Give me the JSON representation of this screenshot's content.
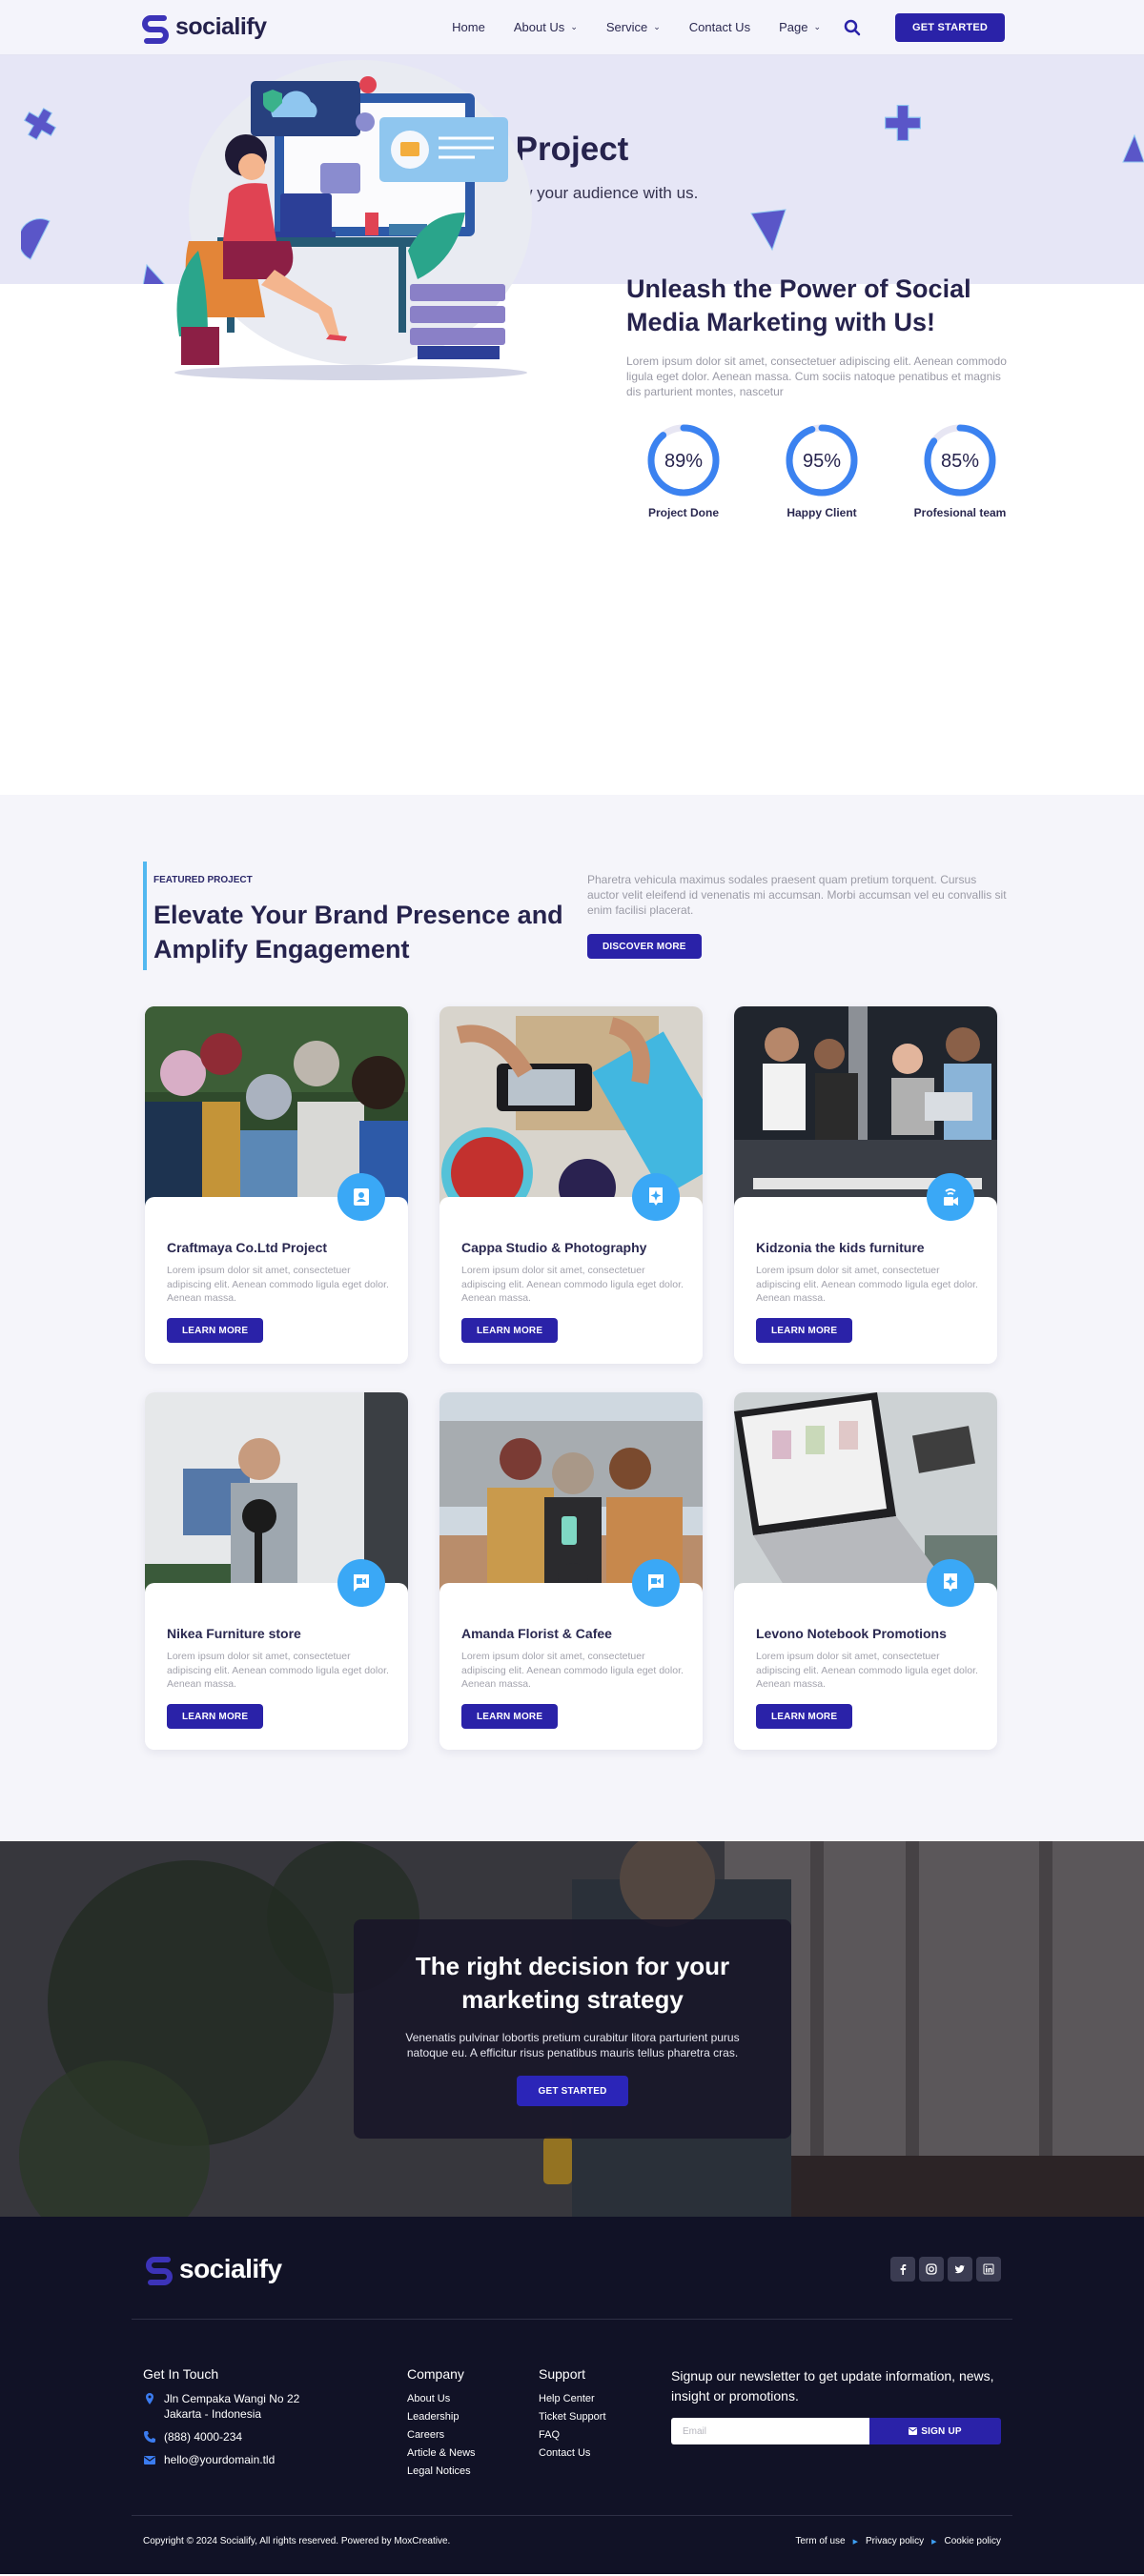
{
  "brand": {
    "name": "socialify",
    "accent": "#2a22a8",
    "icon_blue": "#3aa8f6",
    "ring_blue": "#3b82f0"
  },
  "nav": {
    "items": [
      {
        "label": "Home",
        "has_dropdown": false
      },
      {
        "label": "About Us",
        "has_dropdown": true
      },
      {
        "label": "Service",
        "has_dropdown": true
      },
      {
        "label": "Contact Us",
        "has_dropdown": false
      },
      {
        "label": "Page",
        "has_dropdown": true
      }
    ],
    "search_icon": "search-icon",
    "cta_label": "GET STARTED"
  },
  "hero": {
    "title": "Project",
    "subtitle": "Get to know your audience with us."
  },
  "about": {
    "heading": "Unleash the Power of Social Media Marketing with Us!",
    "text": "Lorem ipsum dolor sit amet, consectetuer adipiscing elit. Aenean commodo ligula eget dolor. Aenean massa. Cum sociis natoque penatibus et magnis dis parturient montes, nascetur",
    "stats": [
      {
        "value": "89%",
        "percent": 89,
        "label": "Project Done"
      },
      {
        "value": "95%",
        "percent": 95,
        "label": "Happy Client"
      },
      {
        "value": "85%",
        "percent": 85,
        "label": "Profesional team"
      }
    ]
  },
  "featured": {
    "eyebrow": "FEATURED PROJECT",
    "title": "Elevate Your Brand Presence and Amplify Engagement",
    "description": "Pharetra vehicula maximus sodales praesent quam pretium torquent. Cursus auctor velit eleifend id venenatis mi accumsan. Morbi accumsan vel eu convallis sit enim facilisi placerat.",
    "button_label": "DISCOVER MORE",
    "projects": [
      {
        "title": "Craftmaya Co.Ltd Project",
        "text": "Lorem ipsum dolor sit amet, consectetuer adipiscing elit. Aenean commodo ligula eget dolor. Aenean massa.",
        "button_label": "LEARN MORE",
        "icon": "contact-card-icon",
        "image": "group-of-friends-in-winter-hats-photo"
      },
      {
        "title": "Cappa Studio & Photography",
        "text": "Lorem ipsum dolor sit amet, consectetuer adipiscing elit. Aenean commodo ligula eget dolor. Aenean massa.",
        "button_label": "LEARN MORE",
        "icon": "sparkle-message-icon",
        "image": "phone-photographing-food-photo"
      },
      {
        "title": "Kidzonia the kids furniture",
        "text": "Lorem ipsum dolor sit amet, consectetuer adipiscing elit. Aenean commodo ligula eget dolor. Aenean massa.",
        "button_label": "LEARN MORE",
        "icon": "live-video-icon",
        "image": "team-meeting-on-sofa-photo"
      },
      {
        "title": "Nikea Furniture store",
        "text": "Lorem ipsum dolor sit amet, consectetuer adipiscing elit. Aenean commodo ligula eget dolor. Aenean massa.",
        "button_label": "LEARN MORE",
        "icon": "video-message-icon",
        "image": "woman-podcasting-photo"
      },
      {
        "title": "Amanda Florist & Cafee",
        "text": "Lorem ipsum dolor sit amet, consectetuer adipiscing elit. Aenean commodo ligula eget dolor. Aenean massa.",
        "button_label": "LEARN MORE",
        "icon": "video-message-icon",
        "image": "friends-looking-at-phone-photo"
      },
      {
        "title": "Levono Notebook Promotions",
        "text": "Lorem ipsum dolor sit amet, consectetuer adipiscing elit. Aenean commodo ligula eget dolor. Aenean massa.",
        "button_label": "LEARN MORE",
        "icon": "sparkle-message-icon",
        "image": "laptop-flower-shop-photo"
      }
    ]
  },
  "cta": {
    "title": "The right decision for your marketing strategy",
    "text": "Venenatis pulvinar lobortis pretium curabitur litora parturient purus natoque eu. A efficitur risus penatibus mauris tellus pharetra cras.",
    "button_label": "GET STARTED"
  },
  "footer": {
    "socials": [
      "facebook-icon",
      "instagram-icon",
      "twitter-icon",
      "linkedin-icon"
    ],
    "contact": {
      "title": "Get In Touch",
      "address_line1": "Jln Cempaka Wangi No 22",
      "address_line2": "Jakarta - Indonesia",
      "phone": "(888) 4000-234",
      "email": "hello@yourdomain.tld"
    },
    "company": {
      "title": "Company",
      "links": [
        "About Us",
        "Leadership",
        "Careers",
        "Article & News",
        "Legal Notices"
      ]
    },
    "support": {
      "title": "Support",
      "links": [
        "Help Center",
        "Ticket Support",
        "FAQ",
        "Contact Us"
      ]
    },
    "newsletter": {
      "title": "Signup our newsletter to get update information, news, insight or promotions.",
      "email_placeholder": "Email",
      "email_value": "",
      "button_label": "SIGN UP"
    },
    "copyright": "Copyright © 2024 Socialify, All rights reserved. Powered by MoxCreative.",
    "legal_links": [
      "Term of use",
      "Privacy policy",
      "Cookie policy"
    ]
  }
}
